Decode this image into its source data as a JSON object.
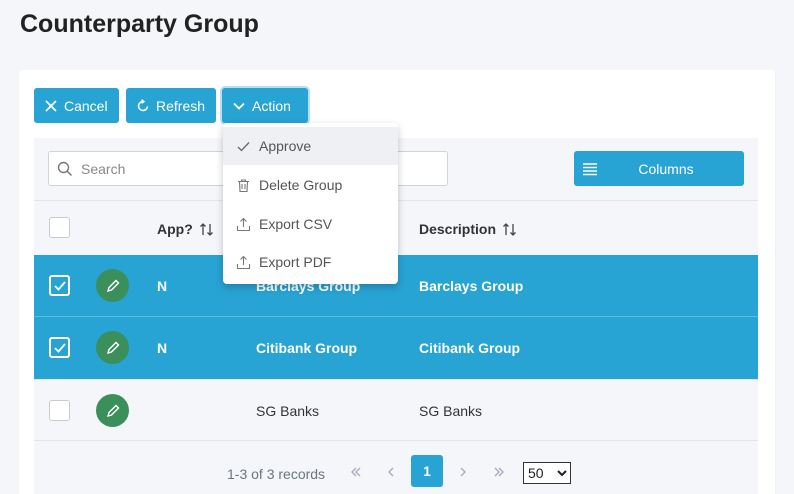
{
  "page": {
    "title": "Counterparty Group"
  },
  "toolbar": {
    "cancel": "Cancel",
    "refresh": "Refresh",
    "action": "Action"
  },
  "search": {
    "placeholder": "Search",
    "value": ""
  },
  "columns_button": "Columns",
  "table": {
    "headers": {
      "approved": "App?",
      "description": "Description"
    },
    "rows": [
      {
        "approved": "N",
        "name": "Barclays Group",
        "description": "Barclays Group",
        "selected": true
      },
      {
        "approved": "N",
        "name": "Citibank Group",
        "description": "Citibank Group",
        "selected": true
      },
      {
        "approved": "",
        "name": "SG Banks",
        "description": "SG Banks",
        "selected": false
      }
    ]
  },
  "pagination": {
    "info": "1-3 of 3 records",
    "current_page": "1",
    "page_size": "50"
  },
  "action_menu": {
    "items": [
      {
        "label": "Approve",
        "icon": "check-icon"
      },
      {
        "label": "Delete Group",
        "icon": "trash-icon"
      },
      {
        "label": "Export CSV",
        "icon": "upload-icon"
      },
      {
        "label": "Export PDF",
        "icon": "upload-icon"
      }
    ]
  },
  "colors": {
    "accent": "#27a3d4",
    "edit": "#3a8f5b",
    "background": "#f4f6f9"
  }
}
